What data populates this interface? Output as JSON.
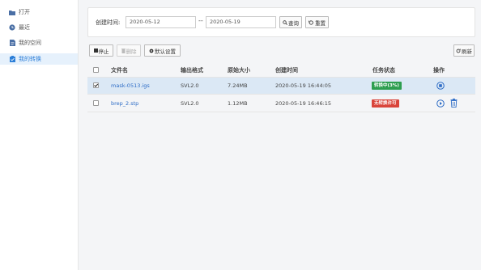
{
  "sidebar": {
    "items": [
      {
        "label": "打开",
        "icon": "folder-icon",
        "active": false
      },
      {
        "label": "最近",
        "icon": "clock-icon",
        "active": false
      },
      {
        "label": "我的空间",
        "icon": "document-icon",
        "active": false
      },
      {
        "label": "我的转换",
        "icon": "clipboard-icon",
        "active": true
      }
    ]
  },
  "search": {
    "label": "创建时间:",
    "start_date": "2020-05-12",
    "end_date": "2020-05-19",
    "separator": "--",
    "query_label": "查询",
    "reset_label": "重置"
  },
  "toolbar": {
    "stop_label": "停止",
    "delete_label": "删除",
    "default_settings_label": "默认设置",
    "refresh_label": "刷新"
  },
  "table": {
    "headers": {
      "file_name": "文件名",
      "output_format": "输出格式",
      "original_size": "原始大小",
      "created_time": "创建时间",
      "task_status": "任务状态",
      "actions": "操作"
    },
    "rows": [
      {
        "checked": true,
        "file_name": "mask-0513.igs",
        "output_format": "SVL2.0",
        "original_size": "7.24MB",
        "created_time": "2020-05-19 16:44:05",
        "status": "转换中(3%)",
        "status_color": "#2e9e4f",
        "actions": [
          "stop"
        ]
      },
      {
        "checked": false,
        "file_name": "brep_2.stp",
        "output_format": "SVL2.0",
        "original_size": "1.12MB",
        "created_time": "2020-05-19 16:46:15",
        "status": "无转换许可",
        "status_color": "#d9453b",
        "actions": [
          "play",
          "delete"
        ]
      }
    ]
  },
  "colors": {
    "accent": "#2d7fd8",
    "link": "#2d6cc6",
    "selected_row": "#dbe8f5"
  }
}
